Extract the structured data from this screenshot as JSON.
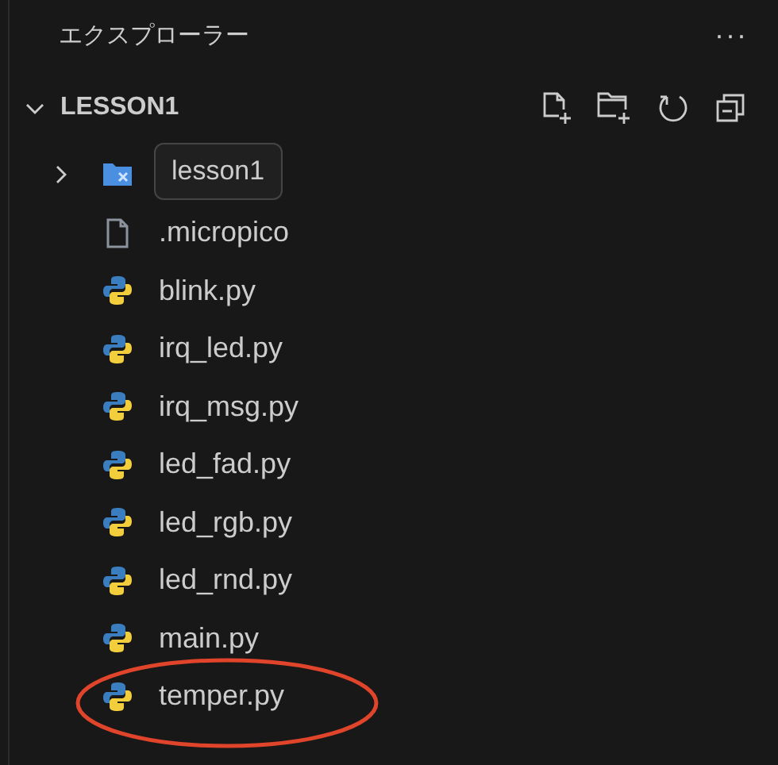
{
  "panel": {
    "title": "エクスプローラー",
    "more": "···"
  },
  "section": {
    "title": "LESSON1",
    "expanded": true
  },
  "items": [
    {
      "kind": "folder",
      "expanded": false,
      "tooltip": "lesson1"
    },
    {
      "kind": "file",
      "name": ".micropico"
    },
    {
      "kind": "python",
      "name": "blink.py"
    },
    {
      "kind": "python",
      "name": "irq_led.py"
    },
    {
      "kind": "python",
      "name": "irq_msg.py"
    },
    {
      "kind": "python",
      "name": "led_fad.py"
    },
    {
      "kind": "python",
      "name": "led_rgb.py"
    },
    {
      "kind": "python",
      "name": "led_rnd.py"
    },
    {
      "kind": "python",
      "name": "main.py"
    },
    {
      "kind": "python",
      "name": "temper.py",
      "circled": true
    }
  ]
}
